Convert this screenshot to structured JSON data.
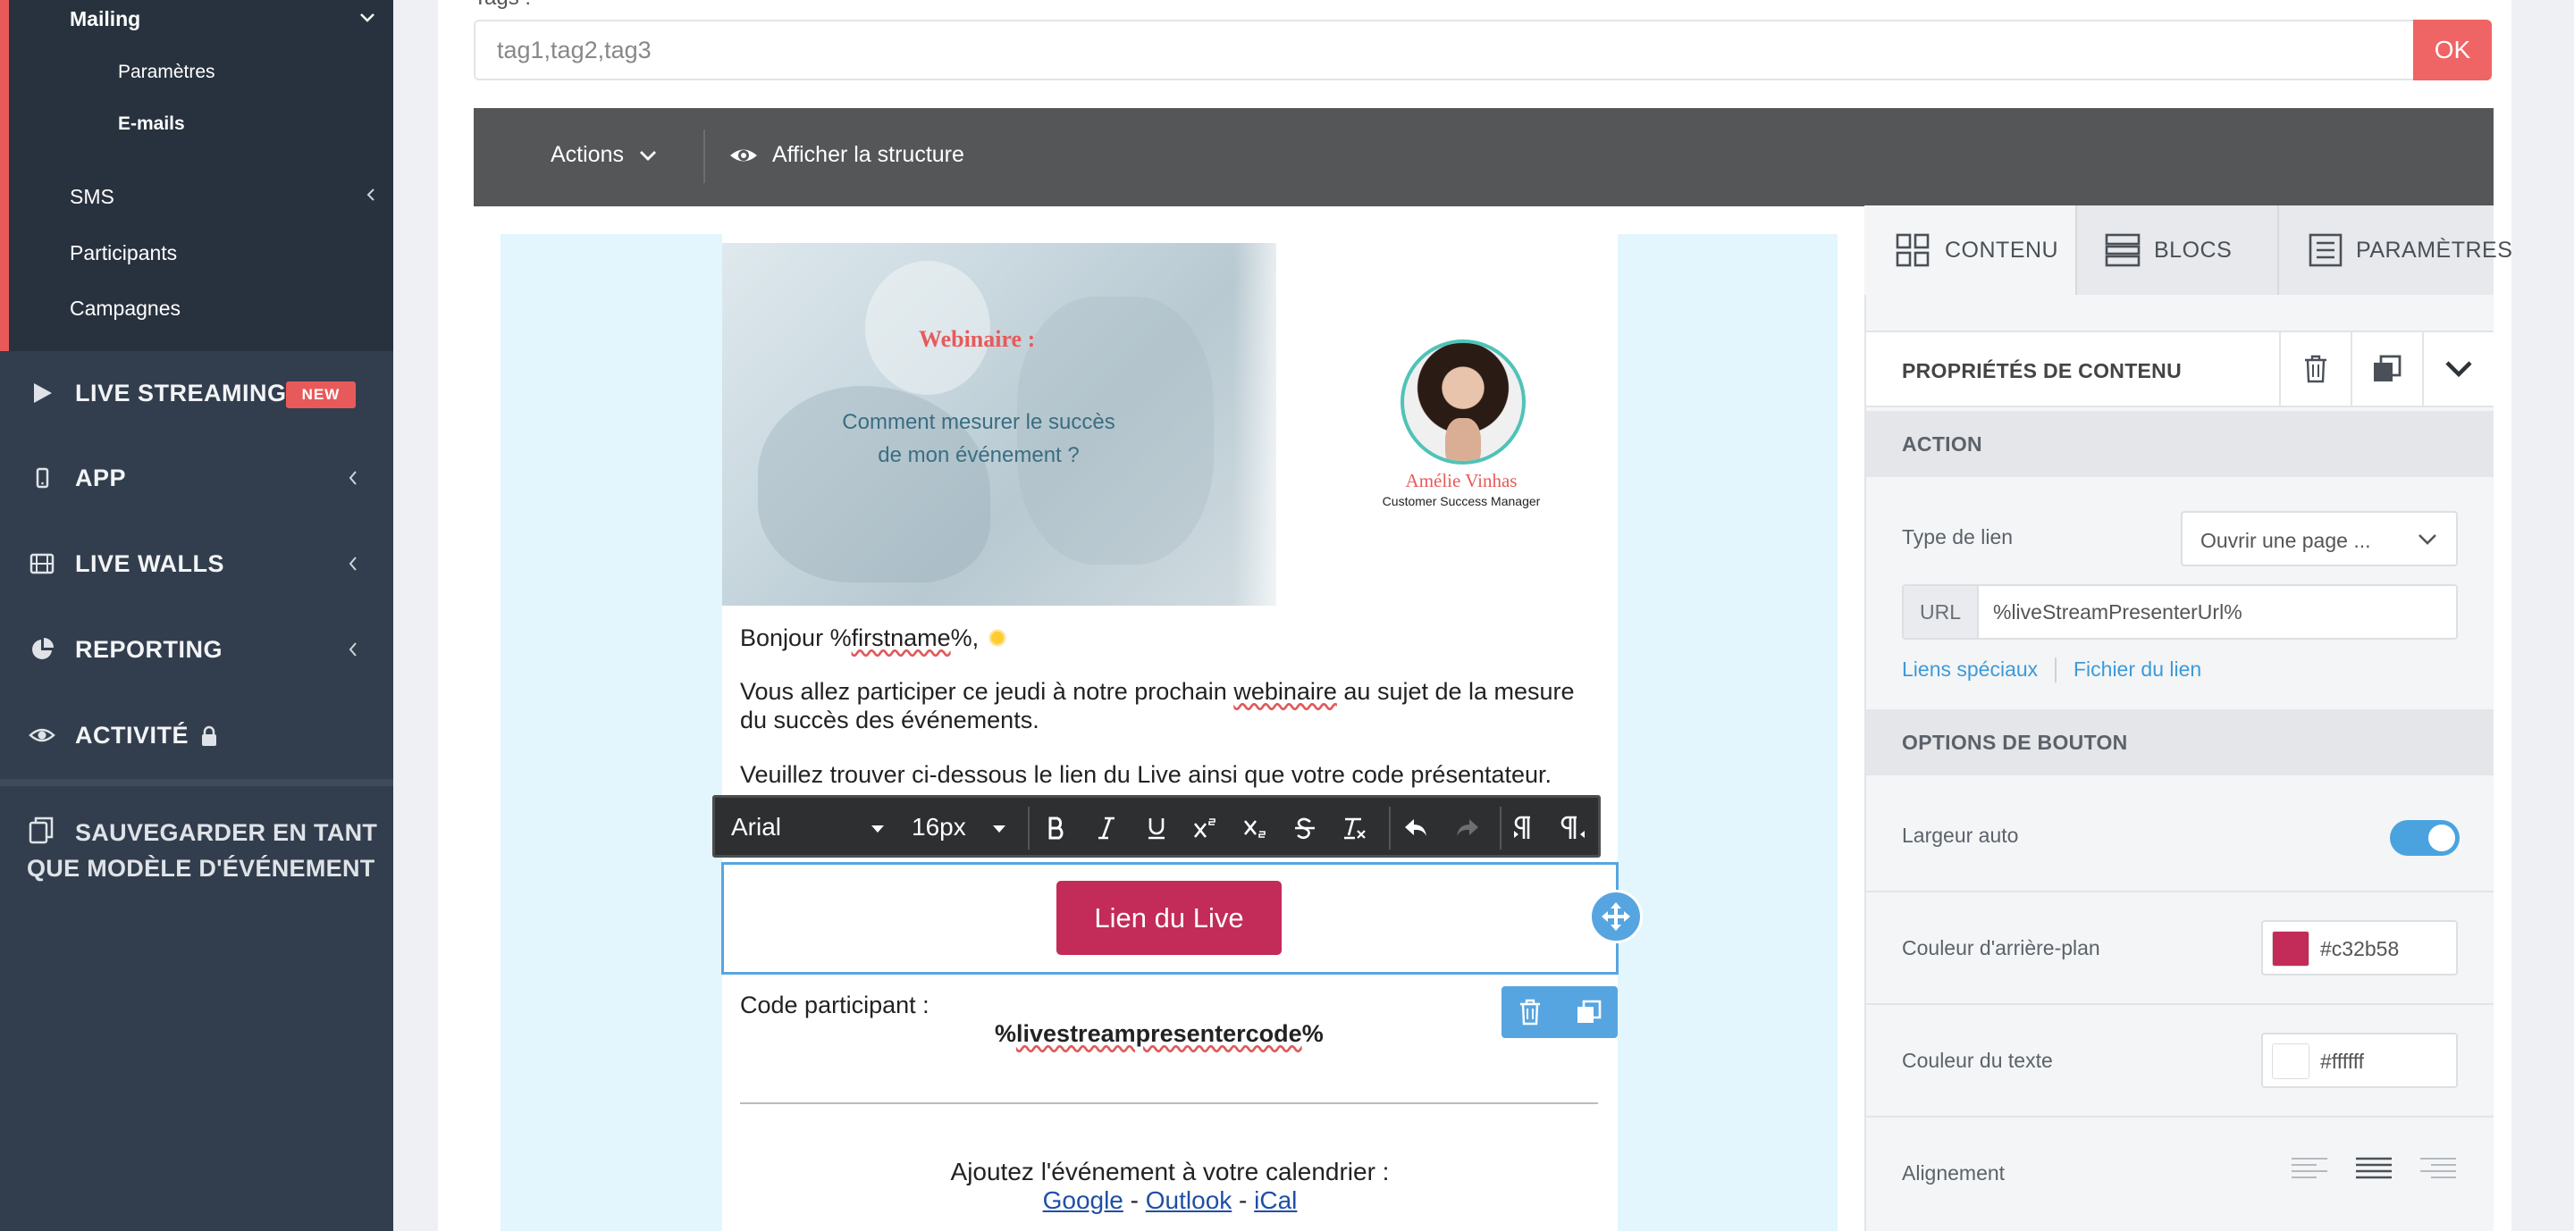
{
  "sidebar": {
    "mailing": {
      "label": "Mailing",
      "sub": [
        "Paramètres",
        "E-mails"
      ]
    },
    "sms": "SMS",
    "participants": "Participants",
    "campagnes": "Campagnes",
    "main_items": [
      {
        "label": "LIVE STREAMING",
        "icon": "play-icon",
        "badge": "NEW"
      },
      {
        "label": "APP",
        "icon": "mobile-icon"
      },
      {
        "label": "LIVE WALLS",
        "icon": "film-icon"
      },
      {
        "label": "REPORTING",
        "icon": "pie-chart-icon"
      },
      {
        "label": "ACTIVITÉ",
        "icon": "eye-icon"
      }
    ],
    "save_template": "SAUVEGARDER EN TANT QUE MODÈLE D'ÉVÉNEMENT"
  },
  "tags": {
    "label": "Tags :",
    "placeholder": "tag1,tag2,tag3",
    "ok": "OK"
  },
  "toolbar": {
    "actions": "Actions",
    "show_structure": "Afficher la structure"
  },
  "email": {
    "hero_title": "Webinaire :",
    "hero_sub_1": "Comment mesurer le succès",
    "hero_sub_2": "de mon événement ?",
    "speaker_name": "Amélie Vinhas",
    "speaker_role": "Customer Success Manager",
    "greeting_pre": "Bonjour %",
    "greeting_var": "firstname",
    "greeting_post": "%,",
    "p1_a": "Vous allez participer ce jeudi à notre prochain ",
    "p1_word": "webinaire",
    "p1_b": " au sujet de la mesure du succès des événements.",
    "p2": "Veuillez trouver ci-dessous le lien du Live ainsi que votre code présentateur.",
    "button": "Lien du Live",
    "code_label": "Code participant :",
    "code_pre": "%",
    "code_var": "livestreampresentercode",
    "code_post": "%",
    "calendar_title": "Ajoutez l'événement à votre calendrier :",
    "cal_google": "Google",
    "cal_outlook": "Outlook",
    "cal_ical": "iCal",
    "sep1": " - ",
    "sep2": "  - "
  },
  "rte": {
    "font": "Arial",
    "size": "16px"
  },
  "panel": {
    "tabs": [
      "CONTENU",
      "BLOCS",
      "PARAMÈTRES"
    ],
    "content_props": "PROPRIÉTÉS DE CONTENU",
    "section_action": "ACTION",
    "link_type_label": "Type de lien",
    "link_type_value": "Ouvrir une page ...",
    "url_prefix": "URL",
    "url_value": "%liveStreamPresenterUrl%",
    "special_links": "Liens spéciaux",
    "file_link": "Fichier du lien",
    "section_button": "OPTIONS DE BOUTON",
    "auto_width": "Largeur auto",
    "bg_color_label": "Couleur d'arrière-plan",
    "bg_color": "#c32b58",
    "text_color_label": "Couleur du texte",
    "text_color": "#ffffff",
    "alignment": "Alignement"
  }
}
